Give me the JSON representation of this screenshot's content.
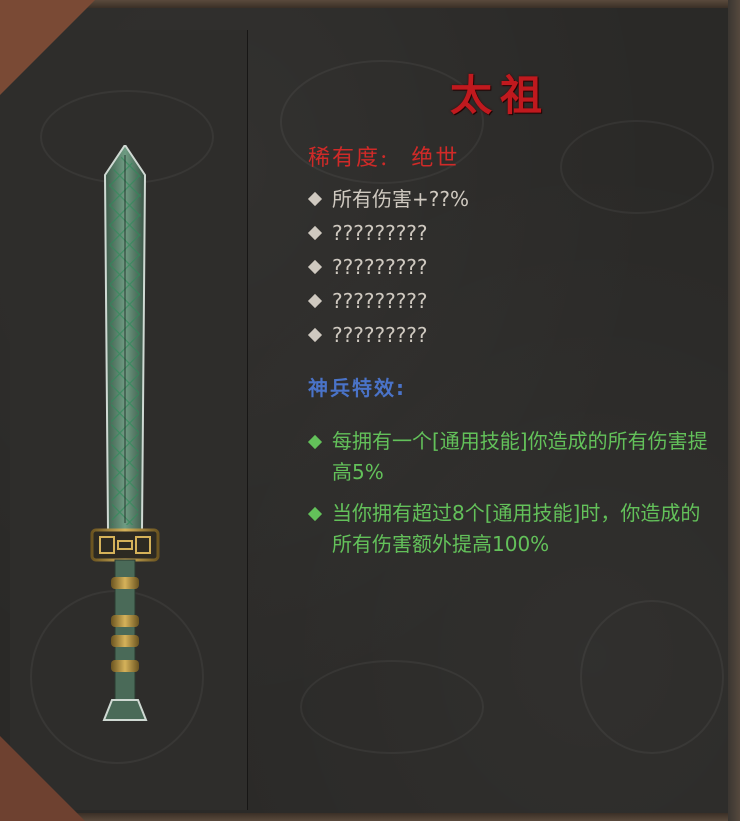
{
  "item": {
    "name": "太祖",
    "rarity_label": "稀有度:",
    "rarity_value": "绝世"
  },
  "stats": [
    "所有伤害+??%",
    "?????????",
    "?????????",
    "?????????",
    "?????????"
  ],
  "special_label": "神兵特效:",
  "effects": [
    "每拥有一个[通用技能]你造成的所有伤害提高5%",
    "当你拥有超过8个[通用技能]时，你造成的所有伤害额外提高100%"
  ],
  "colors": {
    "title": "#c0191e",
    "rarity": "#d02a28",
    "stat_text": "#cfc9c0",
    "special_label": "#4a73c8",
    "effect_text": "#63c15a"
  },
  "icons": {
    "item_image": "jade-bronze-sword-icon",
    "bullet": "diamond-bullet-icon"
  }
}
